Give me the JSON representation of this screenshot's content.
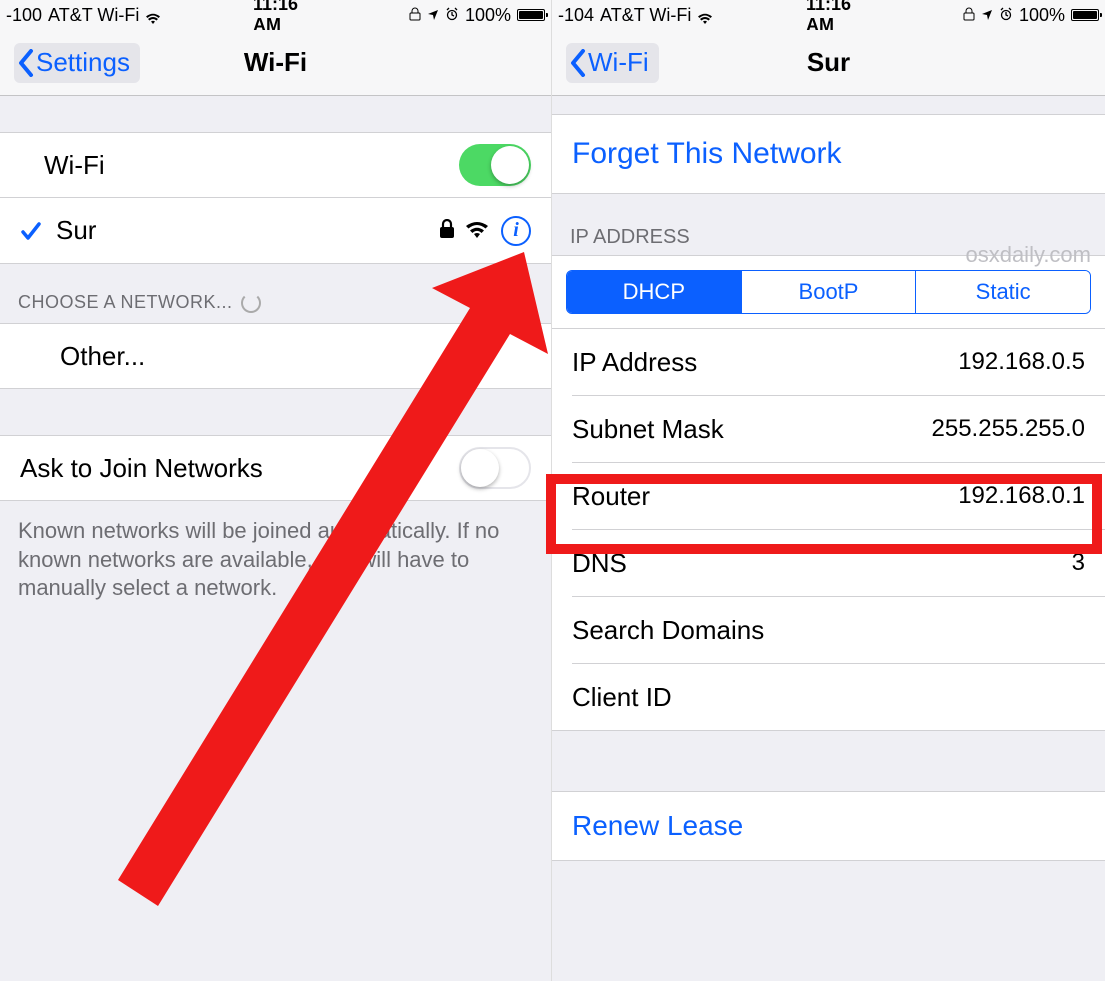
{
  "left": {
    "status": {
      "signal": "-100",
      "carrier": "AT&T Wi-Fi",
      "time": "11:16 AM",
      "battery": "100%"
    },
    "nav": {
      "back": "Settings",
      "title": "Wi-Fi"
    },
    "wifi_row": {
      "label": "Wi-Fi"
    },
    "current_network": {
      "name": "Sur"
    },
    "choose_header": "CHOOSE A NETWORK...",
    "other": "Other...",
    "ask_row": {
      "label": "Ask to Join Networks"
    },
    "ask_footer": "Known networks will be joined automatically. If no known networks are available, you will have to manually select a network."
  },
  "right": {
    "status": {
      "signal": "-104",
      "carrier": "AT&T Wi-Fi",
      "time": "11:16 AM",
      "battery": "100%"
    },
    "nav": {
      "back": "Wi-Fi",
      "title": "Sur"
    },
    "forget": "Forget This Network",
    "ip_header": "IP ADDRESS",
    "watermark": "osxdaily.com",
    "segment": {
      "dhcp": "DHCP",
      "bootp": "BootP",
      "static": "Static"
    },
    "rows": {
      "ip": {
        "label": "IP Address",
        "value": "192.168.0.5"
      },
      "subnet": {
        "label": "Subnet Mask",
        "value": "255.255.255.0"
      },
      "router": {
        "label": "Router",
        "value": "192.168.0.1"
      },
      "dns": {
        "label": "DNS",
        "value": "3"
      },
      "search": {
        "label": "Search Domains",
        "value": ""
      },
      "client": {
        "label": "Client ID",
        "value": ""
      }
    },
    "renew": "Renew Lease"
  }
}
